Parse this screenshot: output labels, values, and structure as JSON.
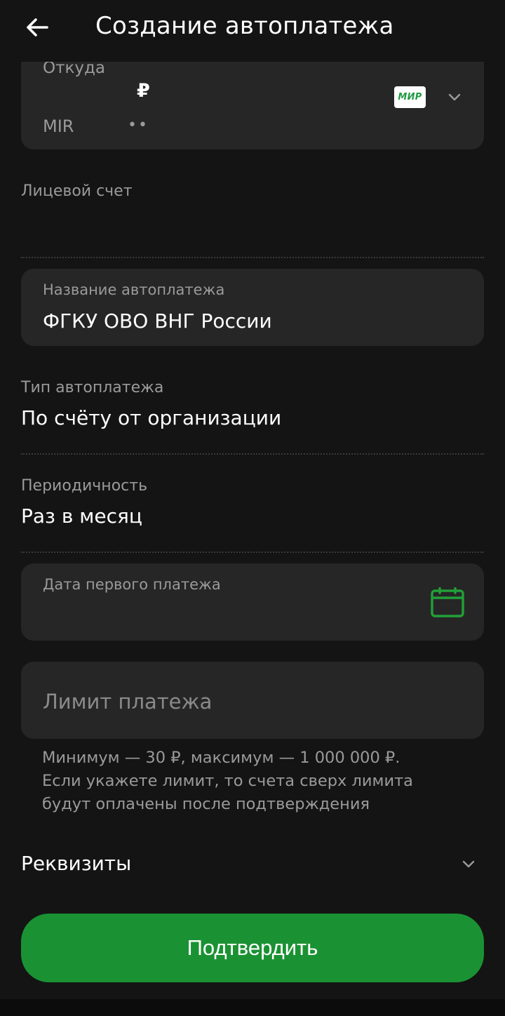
{
  "header": {
    "title": "Создание автоплатежа"
  },
  "source": {
    "label": "Откуда",
    "currency": "₽",
    "card_name": "MIR",
    "card_mask": "••",
    "payment_system": "МИР"
  },
  "account": {
    "label": "Лицевой счет",
    "value": ""
  },
  "name": {
    "label": "Название автоплатежа",
    "value": "ФГКУ ОВО ВНГ России"
  },
  "type": {
    "label": "Тип автоплатежа",
    "value": "По счёту от организации"
  },
  "period": {
    "label": "Периодичность",
    "value": "Раз в месяц"
  },
  "date": {
    "label": "Дата первого платежа",
    "value": ""
  },
  "limit": {
    "placeholder": "Лимит платежа",
    "hint_line1": "Минимум — 30 ₽, максимум — 1 000 000 ₽.",
    "hint_line2": "Если укажете лимит, то счета сверх лимита",
    "hint_line3": "будут оплачены после подтверждения"
  },
  "requisites": {
    "label": "Реквизиты"
  },
  "confirm": {
    "label": "Подтвердить"
  },
  "colors": {
    "background": "#141414",
    "card": "#262626",
    "accent": "#1a9233",
    "icon_green": "#21a038"
  },
  "icons": {
    "back": "arrow-left-icon",
    "dropdown": "chevron-down-icon",
    "calendar": "calendar-icon"
  }
}
